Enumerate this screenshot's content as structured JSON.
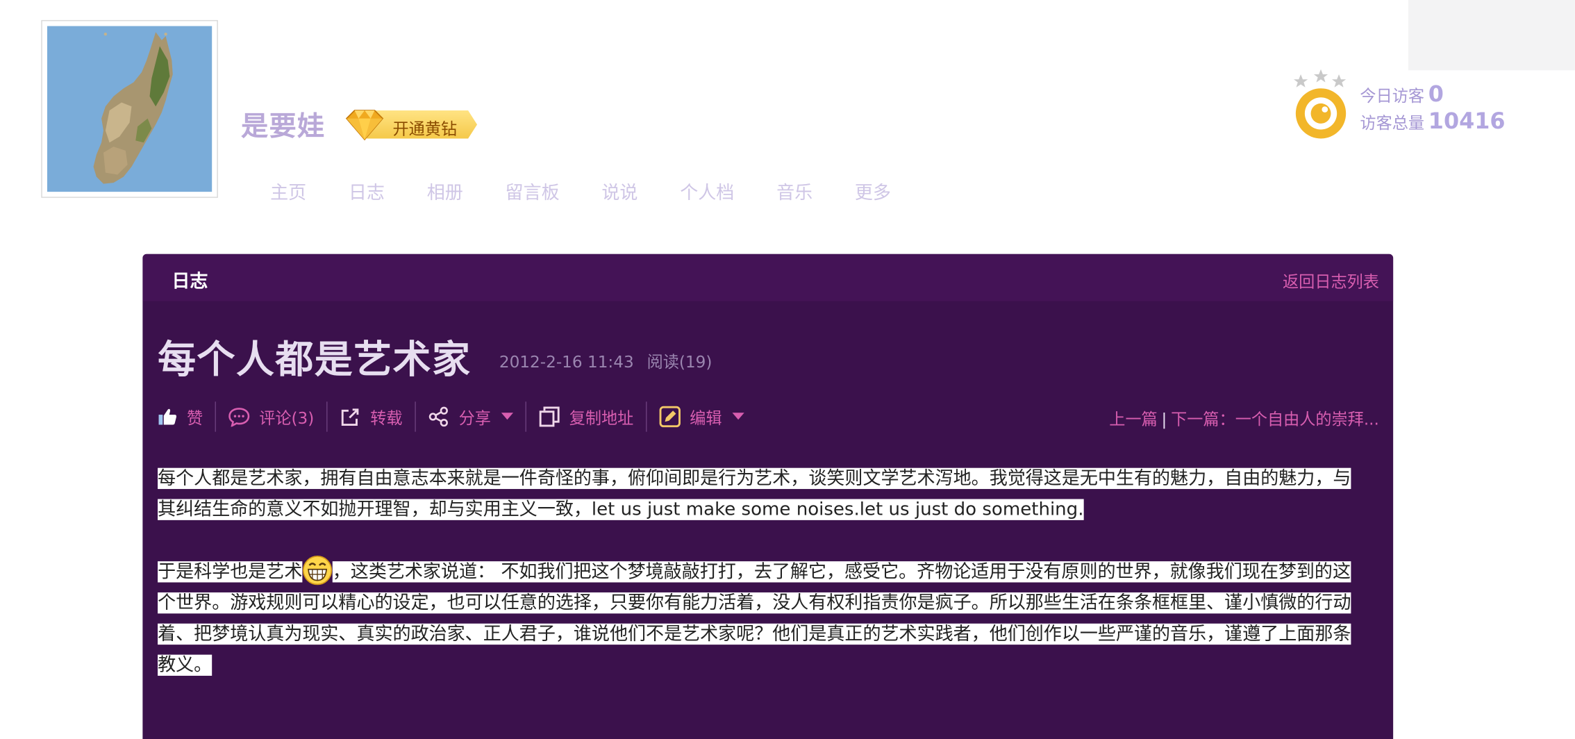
{
  "profile": {
    "username": "是要娃",
    "vip_badge_label": "开通黄钻"
  },
  "nav": {
    "items": [
      "主页",
      "日志",
      "相册",
      "留言板",
      "说说",
      "个人档",
      "音乐",
      "更多"
    ]
  },
  "visitors": {
    "today_label": "今日访客",
    "today_count": "0",
    "total_label": "访客总量",
    "total_count": "10416"
  },
  "panel": {
    "tab_label": "日志",
    "back_link": "返回日志列表"
  },
  "post": {
    "title": "每个人都是艺术家",
    "datetime": "2012-2-16 11:43",
    "reads": "阅读(19)",
    "actions": {
      "like": "赞",
      "comment": "评论(3)",
      "repost": "转载",
      "share": "分享",
      "copy_link": "复制地址",
      "edit": "编辑"
    },
    "prev_label": "上一篇",
    "nav_separator": "|",
    "next_label": "下一篇：一个自由人的崇拜...",
    "paragraph1": "每个人都是艺术家，拥有自由意志本来就是一件奇怪的事，俯仰间即是行为艺术，谈笑则文学艺术泻地。我觉得这是无中生有的魅力，自由的魅力，与其纠结生命的意义不如抛开理智，却与实用主义一致，let us just make some noises.let us just do something.",
    "paragraph2_before": "于是科学也是艺术",
    "paragraph2_after": "，这类艺术家说道： 不如我们把这个梦境敲敲打打，去了解它，感受它。齐物论适用于没有原则的世界，就像我们现在梦到的这个世界。游戏规则可以精心的设定，也可以任意的选择，只要你有能力活着，没人有权利指责你是疯子。所以那些生活在条条框框里、谨小慎微的行动着、把梦境认真为现实、真实的政治家、正人君子，谁说他们不是艺术家呢？他们是真正的艺术实践者，他们创作以一些严谨的音乐，谨遵了上面那条教义。"
  },
  "icons": {
    "like": "thumbs-up-icon",
    "comment": "speech-bubble-icon",
    "repost": "repost-icon",
    "share": "share-icon",
    "copy": "copy-icon",
    "edit": "edit-icon",
    "caret": "chevron-down-icon",
    "visitor": "eye-icon",
    "vip": "diamond-icon",
    "emoji": "grin-emoji-icon"
  },
  "colors": {
    "panel_bg": "#3b114c",
    "panel_header_bg": "#441356",
    "accent_pink": "#d85eb0",
    "username": "#b9a8d8",
    "nav_text": "#cfc6e6",
    "gold": "#f5c94a"
  }
}
